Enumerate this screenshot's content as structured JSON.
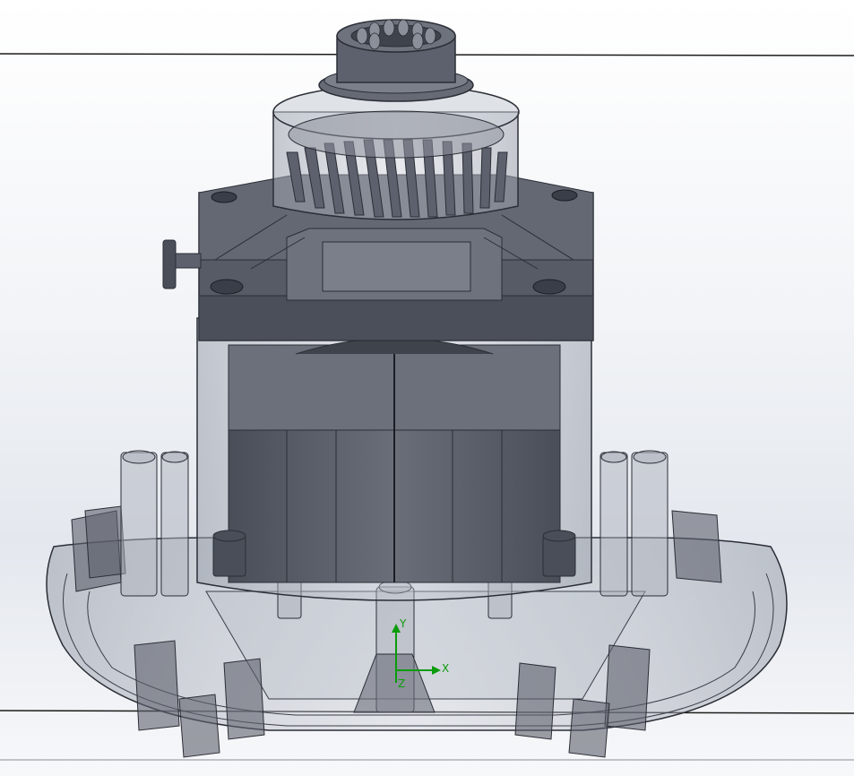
{
  "triad": {
    "x_label": "X",
    "y_label": "Y",
    "z_label": "Z",
    "color": "#0a9c0a"
  },
  "colors": {
    "background_top": "#ffffff",
    "background_mid": "#e4e8ee",
    "edge": "#2b2e36",
    "solid": "#5d616d",
    "solid_dark": "#454953",
    "transparent_fill": "#c8ccd6"
  },
  "icons": {
    "coordinate_triad": "xyz-triad-icon",
    "model": "electric-motor-assembly"
  }
}
